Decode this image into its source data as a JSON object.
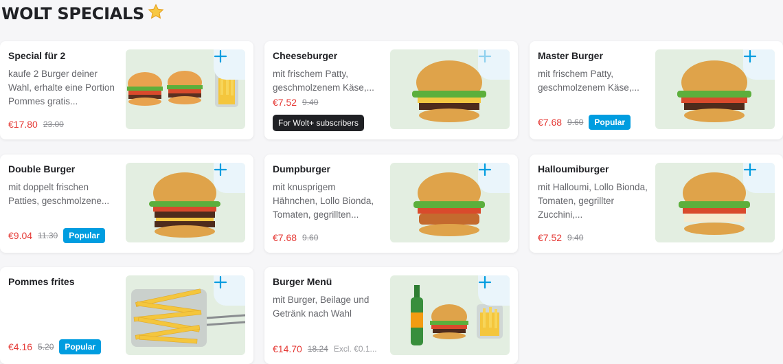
{
  "section": {
    "title": "WOLT SPECIALS",
    "icon": "star-icon"
  },
  "colors": {
    "accent": "#009de0",
    "price": "#e53935",
    "thumb_bg": "#e3eee1"
  },
  "items": [
    {
      "name": "Special für 2",
      "description": "kaufe 2 Burger deiner Wahl, erhalte eine Portion Pommes gratis...",
      "price": "€17.80",
      "old_price": "23.00"
    },
    {
      "name": "Cheeseburger",
      "description": "mit frischem Patty, geschmolzenem Käse,...",
      "price": "€7.52",
      "old_price": "9.40",
      "badge": "For Wolt+ subscribers"
    },
    {
      "name": "Master Burger",
      "description": "mit frischem Patty, geschmolzenem Käse,...",
      "price": "€7.68",
      "old_price": "9.60",
      "badge": "Popular"
    },
    {
      "name": "Double Burger",
      "description": "mit doppelt frischen Patties, geschmolzene...",
      "price": "€9.04",
      "old_price": "11.30",
      "badge": "Popular"
    },
    {
      "name": "Dumpburger",
      "description": "mit knusprigem Hähnchen, Lollo Bionda, Tomaten, gegrillten...",
      "price": "€7.68",
      "old_price": "9.60"
    },
    {
      "name": "Halloumiburger",
      "description": "mit Halloumi, Lollo Bionda, Tomaten, gegrillter Zucchini,...",
      "price": "€7.52",
      "old_price": "9.40"
    },
    {
      "name": "Pommes frites",
      "description": "",
      "price": "€4.16",
      "old_price": "5.20",
      "badge": "Popular"
    },
    {
      "name": "Burger Menü",
      "description": "mit Burger, Beilage und Getränk nach Wahl",
      "price": "€14.70",
      "old_price": "18.24",
      "extra": "Excl. €0.1..."
    }
  ]
}
